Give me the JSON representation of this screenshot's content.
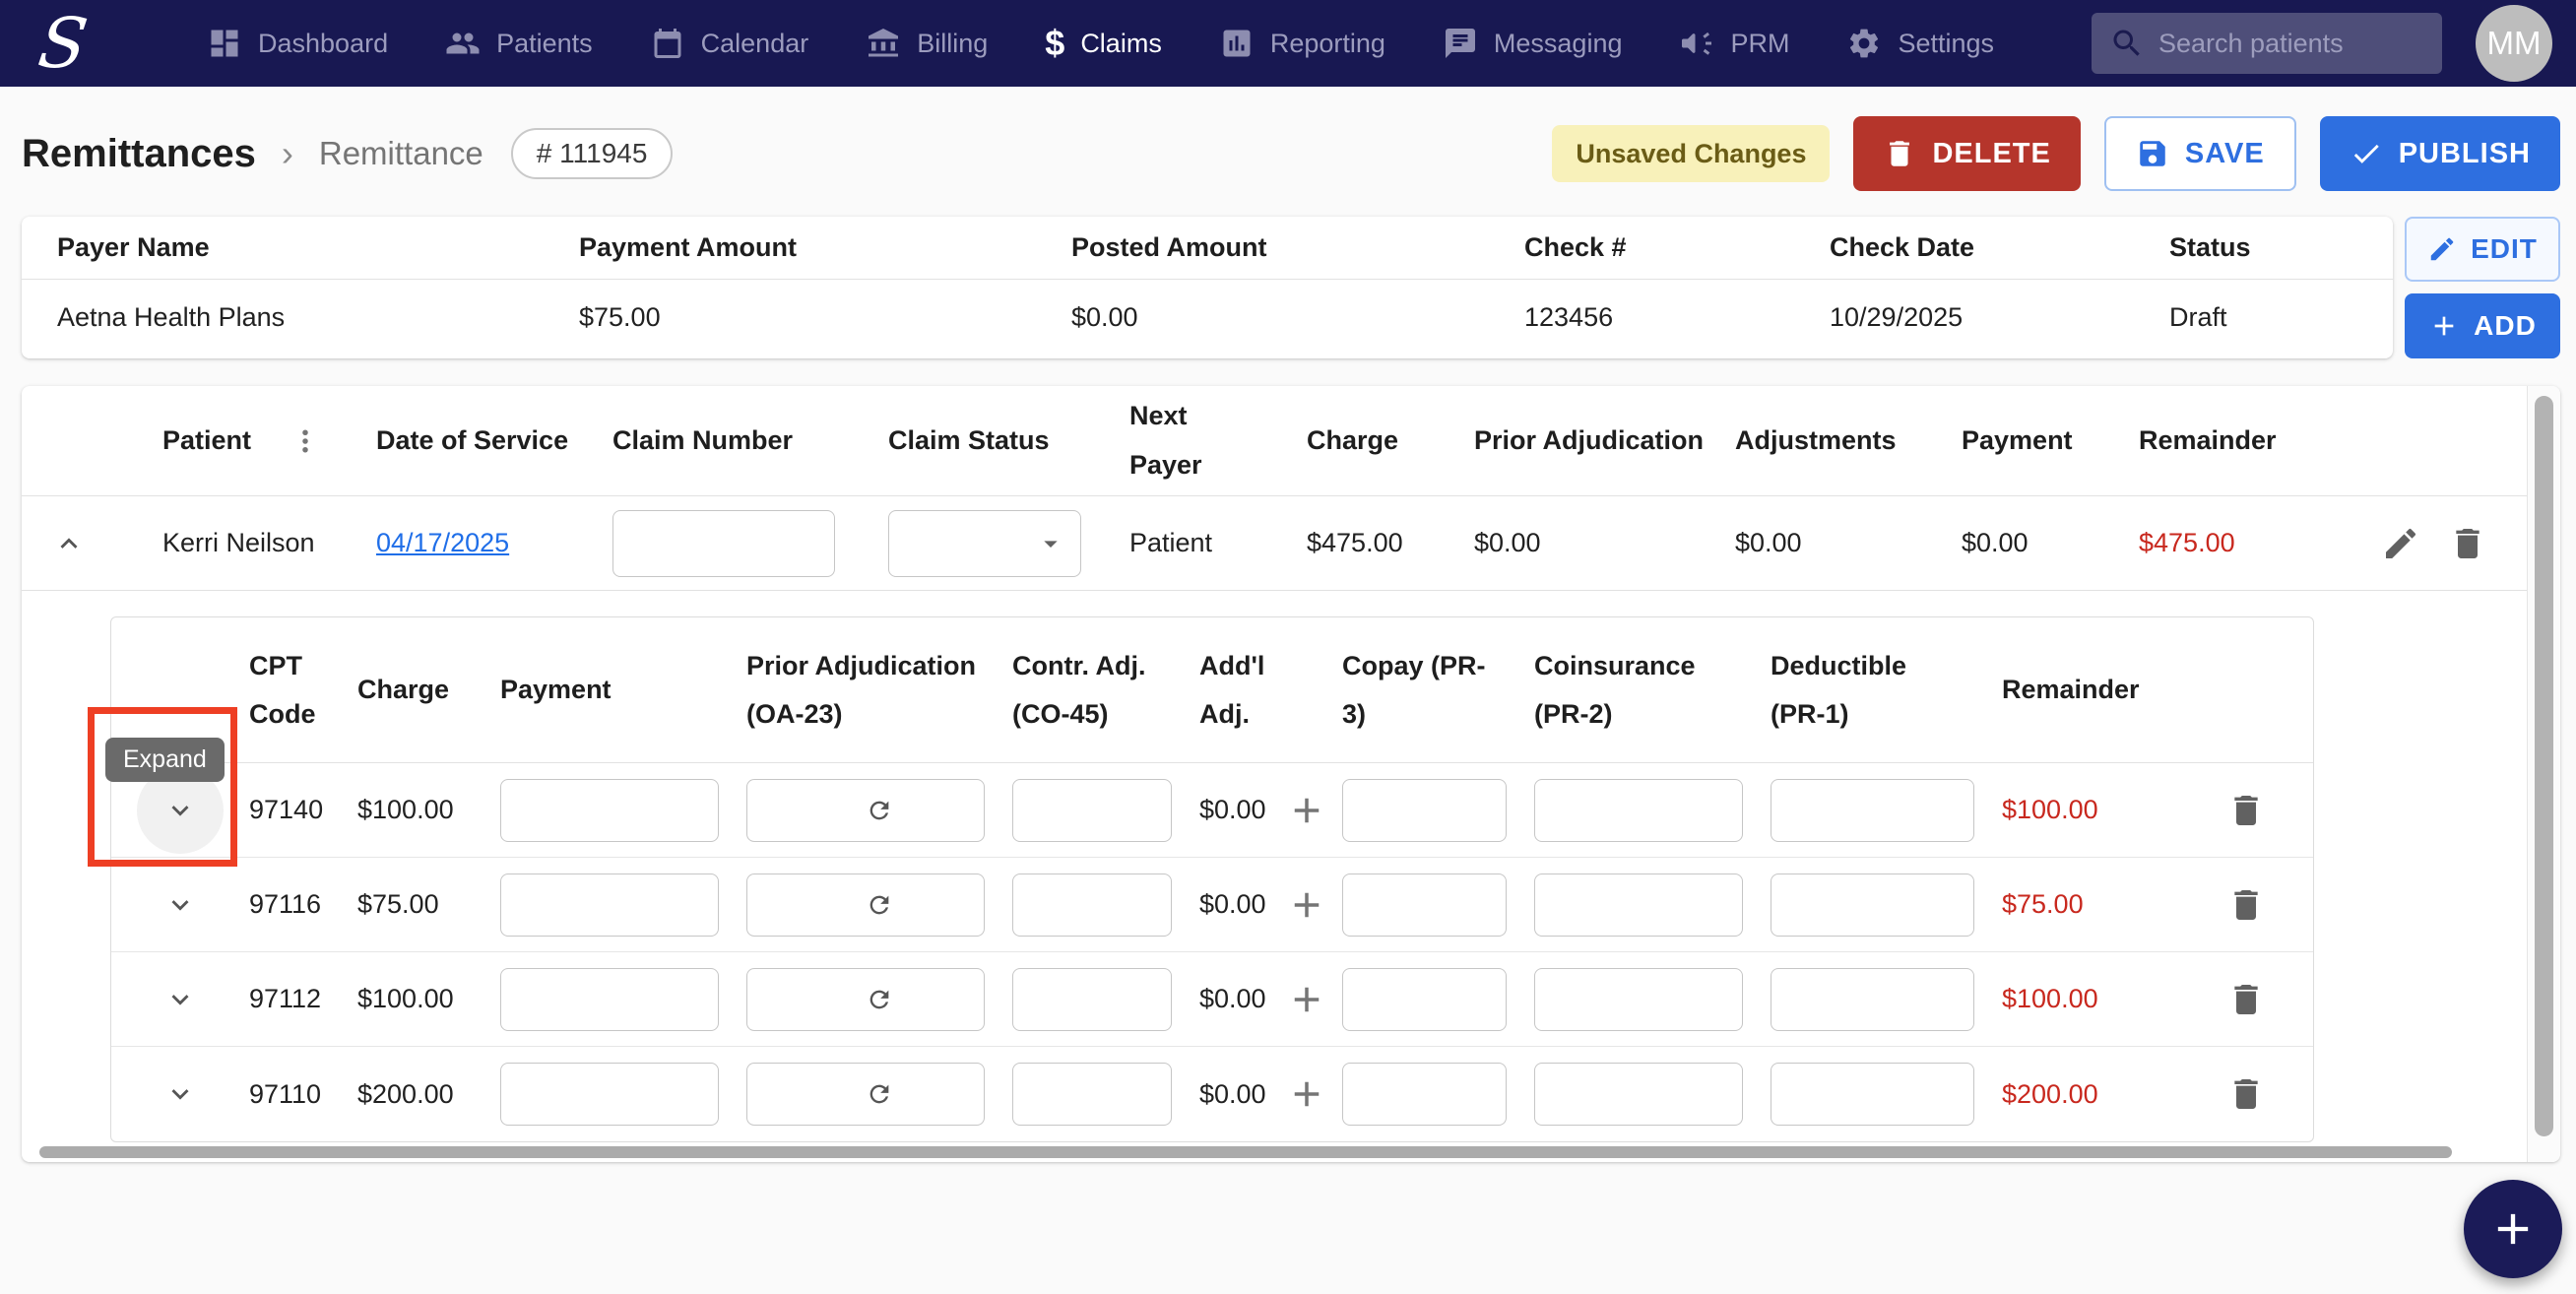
{
  "nav": {
    "search_placeholder": "Search patients",
    "avatar_initials": "MM",
    "items": [
      {
        "label": "Dashboard",
        "active": false
      },
      {
        "label": "Patients",
        "active": false
      },
      {
        "label": "Calendar",
        "active": false
      },
      {
        "label": "Billing",
        "active": false
      },
      {
        "label": "Claims",
        "active": true
      },
      {
        "label": "Reporting",
        "active": false
      },
      {
        "label": "Messaging",
        "active": false
      },
      {
        "label": "PRM",
        "active": false
      },
      {
        "label": "Settings",
        "active": false
      }
    ],
    "claims_icon_glyph": "$"
  },
  "page_header": {
    "breadcrumb_root": "Remittances",
    "breadcrumb_separator": "›",
    "breadcrumb_current": "Remittance",
    "remittance_id_chip": "# 111945",
    "unsaved_badge": "Unsaved Changes",
    "delete_label": "DELETE",
    "save_label": "SAVE",
    "publish_label": "PUBLISH"
  },
  "payer_summary": {
    "columns": [
      "Payer Name",
      "Payment Amount",
      "Posted Amount",
      "Check #",
      "Check Date",
      "Status"
    ],
    "payer_name": "Aetna Health Plans",
    "payment_amount": "$75.00",
    "posted_amount": "$0.00",
    "check_number": "123456",
    "check_date": "10/29/2025",
    "status": "Draft",
    "edit_label": "EDIT",
    "add_label": "ADD"
  },
  "claims_table": {
    "columns": [
      "Patient",
      "Date of Service",
      "Claim Number",
      "Claim Status",
      "Next Payer",
      "Charge",
      "Prior Adjudication",
      "Adjustments",
      "Payment",
      "Remainder"
    ],
    "claim": {
      "patient": "Kerri Neilson",
      "date_of_service": "04/17/2025",
      "claim_number_value": "",
      "claim_status_value": "",
      "next_payer": "Patient",
      "charge": "$475.00",
      "prior_adjudication": "$0.00",
      "adjustments": "$0.00",
      "payment": "$0.00",
      "remainder": "$475.00"
    },
    "service_lines": {
      "columns": [
        "CPT Code",
        "Charge",
        "Payment",
        "Prior Adjudication (OA-23)",
        "Contr. Adj. (CO-45)",
        "Add'l Adj.",
        "Copay (PR-3)",
        "Coinsurance (PR-2)",
        "Deductible (PR-1)",
        "Remainder"
      ],
      "expand_tooltip": "Expand",
      "rows": [
        {
          "cpt_code": "97140",
          "charge": "$100.00",
          "addl_adj": "$0.00",
          "remainder": "$100.00"
        },
        {
          "cpt_code": "97116",
          "charge": "$75.00",
          "addl_adj": "$0.00",
          "remainder": "$75.00"
        },
        {
          "cpt_code": "97112",
          "charge": "$100.00",
          "addl_adj": "$0.00",
          "remainder": "$100.00"
        },
        {
          "cpt_code": "97110",
          "charge": "$200.00",
          "addl_adj": "$0.00",
          "remainder": "$200.00"
        }
      ]
    }
  },
  "colors": {
    "nav_bg": "#181852",
    "accent_blue": "#2e6fe0",
    "delete_red": "#b5352b",
    "amount_red": "#c8281e",
    "unsaved_badge_bg": "#f8f1ba",
    "highlight_red": "#ee3f24",
    "link_blue": "#1f6ee8"
  }
}
